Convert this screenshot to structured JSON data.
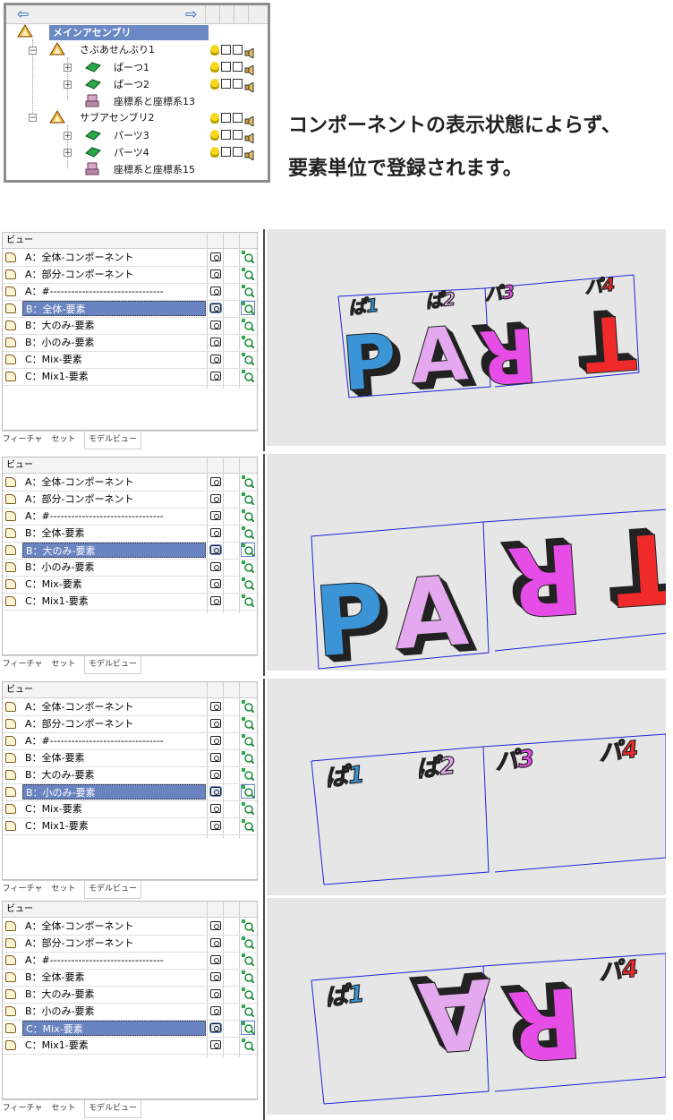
{
  "tree": {
    "back_icon": "arrow-left-icon",
    "forward_icon": "arrow-right-icon",
    "root_label": "メインアセンブリ",
    "items": [
      {
        "label": "さぶあせんぶり1",
        "kind": "assembly"
      },
      {
        "label": "ぱーつ1",
        "kind": "part"
      },
      {
        "label": "ぱーつ2",
        "kind": "part"
      },
      {
        "label": "座標系と座標系13",
        "kind": "coord"
      },
      {
        "label": "サブアセンブリ2",
        "kind": "assembly"
      },
      {
        "label": "パーツ3",
        "kind": "part"
      },
      {
        "label": "パーツ4",
        "kind": "part"
      },
      {
        "label": "座標系と座標系15",
        "kind": "coord"
      }
    ]
  },
  "headline": {
    "line1": "コンポーネントの表示状態によらず、",
    "line2": "要素単位で登録されます。"
  },
  "view_panel": {
    "header": "ビュー",
    "tabs": [
      "フィーチャ",
      "セット",
      "モデルビュー"
    ],
    "active_tab": 2,
    "rows": [
      "A：全体-コンポーネント",
      "A：部分-コンポーネント",
      "A：#--------------------------------",
      "B：全体-要素",
      "B：大のみ-要素",
      "B：小のみ-要素",
      "C：Mix-要素",
      "C：Mix1-要素"
    ]
  },
  "blocks": [
    {
      "selected_index": 3,
      "scene": "B：全体-要素"
    },
    {
      "selected_index": 4,
      "scene": "B：大のみ-要素"
    },
    {
      "selected_index": 5,
      "scene": "B：小のみ-要素"
    },
    {
      "selected_index": 6,
      "scene": "C：Mix-要素"
    }
  ],
  "small_labels": [
    "ぱ1",
    "ぱ2",
    "パ3",
    "パ4"
  ],
  "big_letters": [
    "P",
    "A",
    "R",
    "T"
  ],
  "colors": {
    "selection": "#6a84c2",
    "viewport_bg": "#e6e6e6",
    "frame_blue": "#2222dd",
    "P": "#3a94d6",
    "A": "#e4a8ee",
    "R": "#e64de6",
    "T": "#f02a2a"
  }
}
